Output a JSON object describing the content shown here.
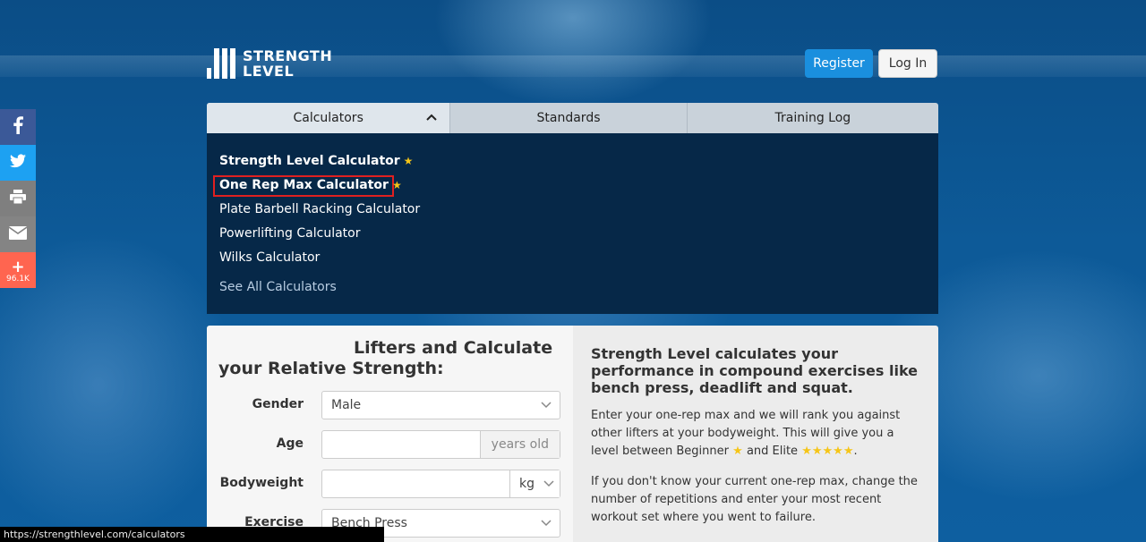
{
  "logo": {
    "line1": "STRENGTH",
    "line2": "LEVEL"
  },
  "header": {
    "register_label": "Register",
    "login_label": "Log In"
  },
  "social": {
    "facebook": "f",
    "twitter": "t",
    "print": "print-icon",
    "email": "email-icon",
    "share": "+",
    "share_count": "96.1K"
  },
  "nav": {
    "tabs": [
      {
        "label": "Calculators"
      },
      {
        "label": "Standards"
      },
      {
        "label": "Training Log"
      }
    ]
  },
  "dropdown": {
    "items": [
      {
        "label": "Strength Level Calculator",
        "star": "★"
      },
      {
        "label": "One Rep Max Calculator",
        "star": "★"
      },
      {
        "label": "Plate Barbell Racking Calculator"
      },
      {
        "label": "Powerlifting Calculator"
      },
      {
        "label": "Wilks Calculator"
      }
    ],
    "see_all": "See All Calculators"
  },
  "form": {
    "title_line1": "Lifters and Calculate",
    "title_line2": "your Relative Strength:",
    "gender_label": "Gender",
    "gender_value": "Male",
    "age_label": "Age",
    "age_value": "",
    "age_unit": "years old",
    "bodyweight_label": "Bodyweight",
    "bodyweight_value": "",
    "bodyweight_unit": "kg",
    "exercise_label": "Exercise",
    "exercise_value": "Bench Press"
  },
  "info": {
    "title": "Strength Level calculates your performance in compound exercises like bench press, deadlift and squat.",
    "p1_a": "Enter your one-rep max and we will rank you against other lifters at your bodyweight. This will give you a level between Beginner",
    "p1_star1": "★",
    "p1_b": "and Elite",
    "p1_star5": "★★★★★",
    "p1_c": ".",
    "p2": "If you don't know your current one-rep max, change the number of repetitions and enter your most recent workout set where you went to failure."
  },
  "status_bar": {
    "url": "https://strengthlevel.com/calculators"
  },
  "colors": {
    "accent": "#1a8fde",
    "dropdown_bg": "#062848",
    "highlight": "#e02020",
    "star": "#f5c518"
  }
}
